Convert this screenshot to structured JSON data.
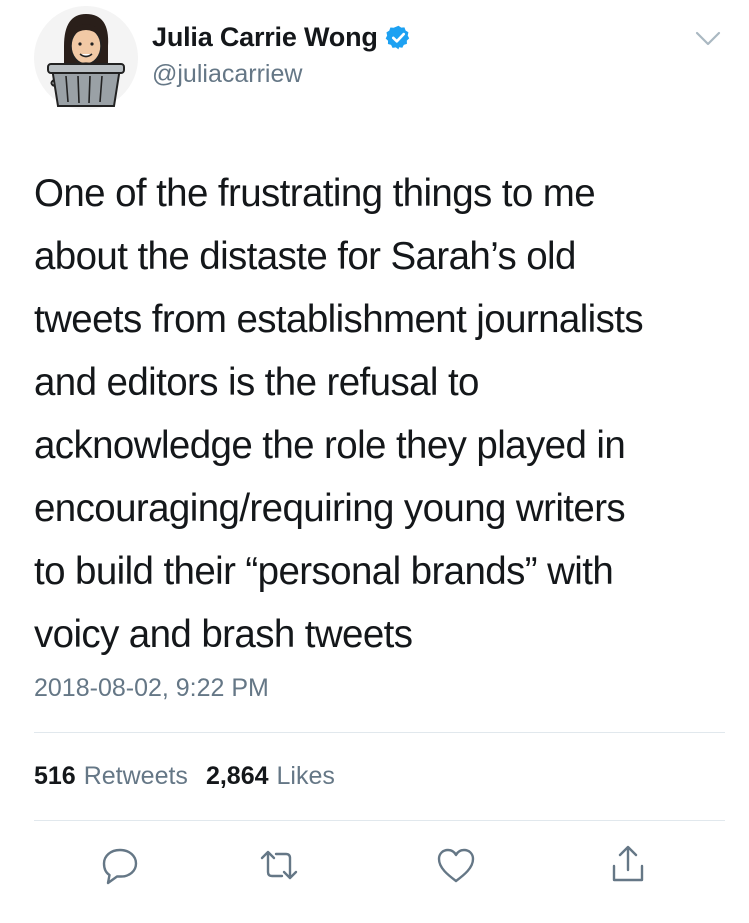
{
  "author": {
    "display_name": "Julia Carrie Wong",
    "handle": "@juliacarriew",
    "verified_icon": "verified-badge-icon",
    "avatar_icon": "avatar-trash-can-illustration"
  },
  "tweet": {
    "text": "One of the frustrating things to me\nabout the distaste for Sarah’s old\ntweets from establishment journalists\nand editors is the refusal to\nacknowledge the role they played in\nencouraging/requiring young writers\nto build their “personal brands” with\nvoicy and brash tweets",
    "timestamp": "2018-08-02, 9:22 PM"
  },
  "stats": {
    "retweets_count": "516",
    "retweets_label": "Retweets",
    "likes_count": "2,864",
    "likes_label": "Likes"
  },
  "actions": [
    "reply-icon",
    "retweet-icon",
    "like-icon",
    "share-icon"
  ],
  "colors": {
    "text": "#14171a",
    "secondary": "#657786",
    "verified": "#1da1f2",
    "divider": "#e1e8ed"
  }
}
